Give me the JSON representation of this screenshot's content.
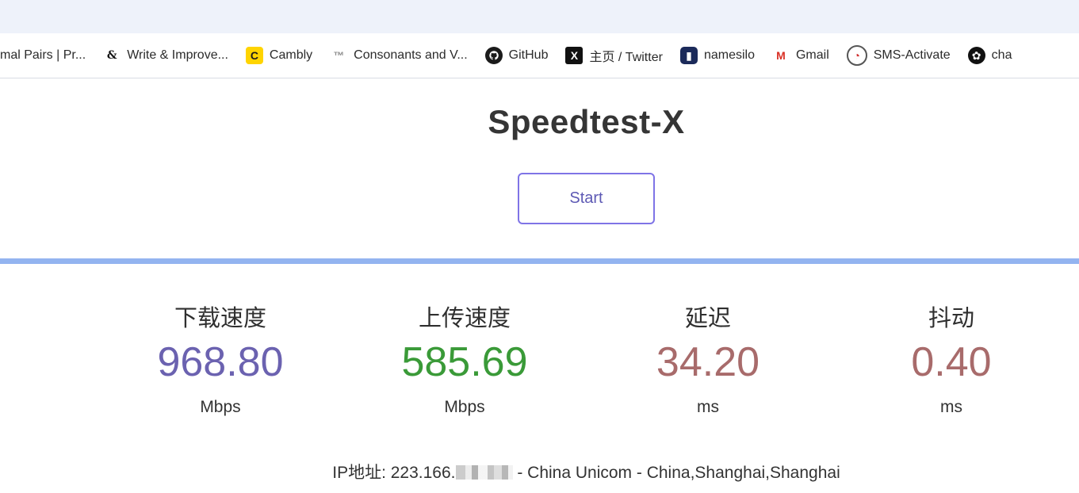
{
  "bookmarks": [
    {
      "label": "mal Pairs | Pr...",
      "icon": "none"
    },
    {
      "label": "Write & Improve...",
      "icon": "ampersand-icon"
    },
    {
      "label": "Cambly",
      "icon": "cambly-icon"
    },
    {
      "label": "Consonants and V...",
      "icon": "consonants-site-icon"
    },
    {
      "label": "GitHub",
      "icon": "github-icon"
    },
    {
      "label": "主页 / Twitter",
      "icon": "x-twitter-icon"
    },
    {
      "label": "namesilo",
      "icon": "namesilo-icon"
    },
    {
      "label": "Gmail",
      "icon": "gmail-icon"
    },
    {
      "label": "SMS-Activate",
      "icon": "sms-activate-icon"
    },
    {
      "label": "cha",
      "icon": "chatgpt-icon"
    }
  ],
  "page": {
    "title": "Speedtest-X",
    "start_label": "Start",
    "progress": 1.0,
    "progress_color": "#93b4f0"
  },
  "metrics": {
    "download": {
      "label": "下载速度",
      "value": "968.80",
      "unit": "Mbps",
      "color": "#6b62b0"
    },
    "upload": {
      "label": "上传速度",
      "value": "585.69",
      "unit": "Mbps",
      "color": "#3a9a38"
    },
    "latency": {
      "label": "延迟",
      "value": "34.20",
      "unit": "ms",
      "color": "#a86b6b"
    },
    "jitter": {
      "label": "抖动",
      "value": "0.40",
      "unit": "ms",
      "color": "#a86b6b"
    }
  },
  "ip_info": {
    "prefix": "IP地址: 223.166.",
    "suffix": " - China Unicom - China,Shanghai,Shanghai"
  }
}
